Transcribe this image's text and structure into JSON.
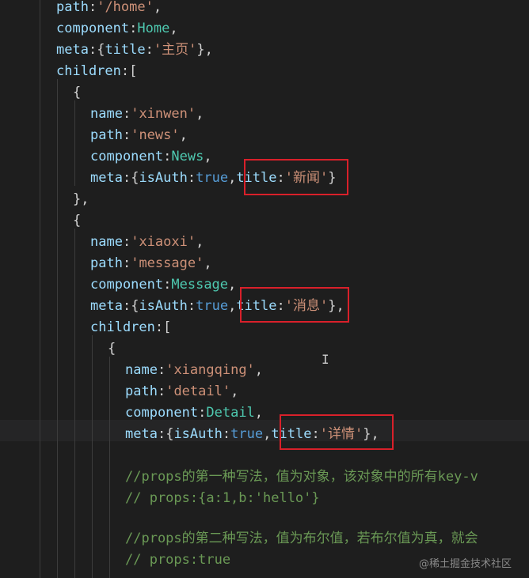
{
  "lines": {
    "l0": {
      "key": "path",
      "colon": ":",
      "val": "'/home'",
      "end": ","
    },
    "l1": {
      "key": "component",
      "colon": ":",
      "val": "Home",
      "end": ","
    },
    "l2": {
      "key": "meta",
      "open": ":{",
      "k2": "title",
      "colon2": ":",
      "val": "'主页'",
      "end": "},"
    },
    "l3": {
      "key": "children",
      "open": ":["
    },
    "l4": {
      "text": "{"
    },
    "l5": {
      "key": "name",
      "colon": ":",
      "val": "'xinwen'",
      "end": ","
    },
    "l6": {
      "key": "path",
      "colon": ":",
      "val": "'news'",
      "end": ","
    },
    "l7": {
      "key": "component",
      "colon": ":",
      "val": "News",
      "end": ","
    },
    "l8": {
      "key": "meta",
      "open": ":{",
      "k2": "isAuth",
      "colon2": ":",
      "bool": "true",
      "comma": ",",
      "k3": "title",
      "colon3": ":",
      "val": "'新闻'",
      "end": "}"
    },
    "l9": {
      "text": "},"
    },
    "l10": {
      "text": "{"
    },
    "l11": {
      "key": "name",
      "colon": ":",
      "val": "'xiaoxi'",
      "end": ","
    },
    "l12": {
      "key": "path",
      "colon": ":",
      "val": "'message'",
      "end": ","
    },
    "l13": {
      "key": "component",
      "colon": ":",
      "val": "Message",
      "end": ","
    },
    "l14": {
      "key": "meta",
      "open": ":{",
      "k2": "isAuth",
      "colon2": ":",
      "bool": "true",
      "comma": ",",
      "k3": "title",
      "colon3": ":",
      "val": "'消息'",
      "end": "},"
    },
    "l15": {
      "key": "children",
      "open": ":["
    },
    "l16": {
      "text": "{"
    },
    "l17": {
      "key": "name",
      "colon": ":",
      "val": "'xiangqing'",
      "end": ","
    },
    "l18": {
      "key": "path",
      "colon": ":",
      "val": "'detail'",
      "end": ","
    },
    "l19": {
      "key": "component",
      "colon": ":",
      "val": "Detail",
      "end": ","
    },
    "l20": {
      "key": "meta",
      "open": ":{",
      "k2": "isAuth",
      "colon2": ":",
      "bool": "true",
      "comma": ",",
      "k3": "title",
      "colon3": ":",
      "val": "'详情'",
      "end": "},"
    },
    "l21": {
      "text": "//props的第一种写法，值为对象，该对象中的所有key-v"
    },
    "l22": {
      "text": "// props:{a:1,b:'hello'}"
    },
    "l23": {
      "text": "//props的第二种写法，值为布尔值，若布尔值为真，就会"
    },
    "l24": {
      "text": "// props:true"
    }
  },
  "cursor_glyph": "I",
  "watermark": "@稀土掘金技术社区",
  "colors": {
    "background": "#1e1e1e",
    "highlight_box": "#d9202a",
    "property": "#9cdcfe",
    "string": "#ce9178",
    "component": "#4ec9b0",
    "boolean": "#569cd6",
    "comment": "#6a9955"
  }
}
